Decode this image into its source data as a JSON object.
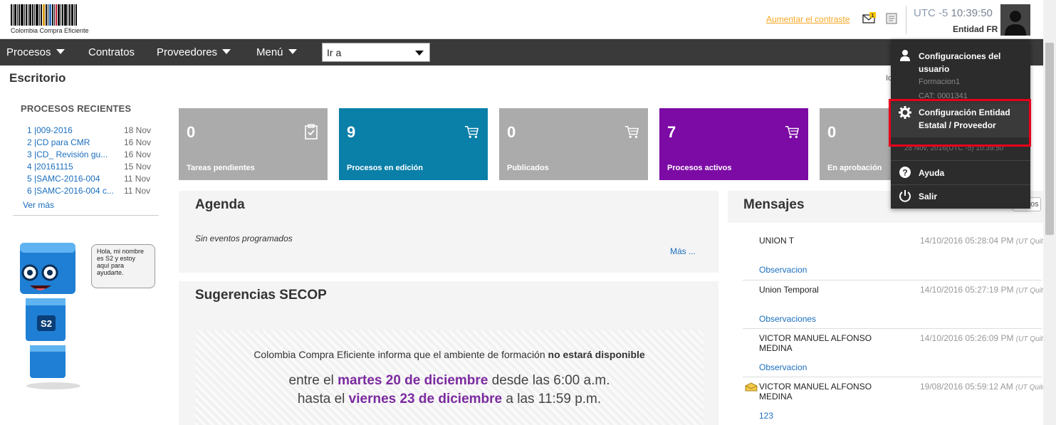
{
  "header": {
    "logo_text": "Colombia Compra Eficiente",
    "contrast_link": "Aumentar el contraste",
    "mail_badge": "1",
    "timezone": "UTC -5",
    "time": "10:39:50",
    "entity": "Entidad FR"
  },
  "nav": {
    "items": [
      {
        "label": "Procesos"
      },
      {
        "label": "Contratos"
      },
      {
        "label": "Proveedores"
      },
      {
        "label": "Menú"
      }
    ],
    "goto_value": "Ir a"
  },
  "page_title": "Escritorio",
  "sidebar": {
    "recent_title": "PROCESOS RECIENTES",
    "recent": [
      {
        "name": "1 |009-2016",
        "date": "18 Nov"
      },
      {
        "name": "2 |CD para CMR",
        "date": "16 Nov"
      },
      {
        "name": "3 |CD_ Revisión gu...",
        "date": "16 Nov"
      },
      {
        "name": "4 |20161115",
        "date": "15 Nov"
      },
      {
        "name": "5 |SAMC-2016-004",
        "date": "11 Nov"
      },
      {
        "name": "6 |SAMC-2016-004 c...",
        "date": "11 Nov"
      }
    ],
    "ver_mas": "Ver más",
    "bubble": "Hola, mi nombre es S2 y estoy aquí para ayudarte.",
    "robot_badge": "S2"
  },
  "tiles": [
    {
      "count": "0",
      "label": "Tareas pendientes",
      "color": "#ababab",
      "icon": "clipboard-check-icon"
    },
    {
      "count": "9",
      "label": "Procesos en edición",
      "color": "#0a7fa8",
      "icon": "cart-icon"
    },
    {
      "count": "0",
      "label": "Publicados",
      "color": "#ababab",
      "icon": "cart-icon"
    },
    {
      "count": "7",
      "label": "Procesos activos",
      "color": "#7c0aa5",
      "icon": "cart-icon"
    },
    {
      "count": "0",
      "label": "En aprobación",
      "color": "#ababab",
      "icon": "cart-icon"
    }
  ],
  "agenda": {
    "title": "Agenda",
    "empty": "Sin eventos programados",
    "more": "Más ..."
  },
  "suggestions": {
    "title": "Sugerencias SECOP",
    "line1_a": "Colombia Compra Eficiente informa que el ambiente de formación ",
    "line1_b": "no estará disponible",
    "line2_a": "entre el ",
    "line2_b": "martes 20 de diciembre",
    "line2_c": " desde las 6:00 a.m.",
    "line3_a": "hasta el ",
    "line3_b": "viernes 23 de diciembre",
    "line3_c": " a las 11:59 p.m."
  },
  "messages": {
    "title": "Mensajes",
    "button_fragment": "os",
    "items": [
      {
        "sender": "UNION T",
        "date": "14/10/2016 05:28:04 PM",
        "tz": "(UT Quito)",
        "subject": "Observacion"
      },
      {
        "sender": "Union Temporal",
        "date": "14/10/2016 05:27:19 PM",
        "tz": "(UT Quito)",
        "subject": "Observaciones"
      },
      {
        "sender": "VICTOR MANUEL ALFONSO MEDINA",
        "date": "14/10/2016 05:26:09 PM",
        "tz": "(UT Quito)",
        "subject": "Observacion"
      },
      {
        "sender": "VICTOR MANUEL ALFONSO MEDINA",
        "date": "19/08/2016 05:59:12 AM",
        "tz": "(UT Quito)",
        "subject": "123"
      }
    ]
  },
  "user_menu": {
    "user_settings": "Configuraciones del usuario",
    "user_name": "Formacion1",
    "user_code": "CAT: 0001341",
    "entity_settings": "Configuración Entidad Estatal / Proveedor",
    "timestamp": "28 Nov, 2016(UTC -5) 10:39:50",
    "help": "Ayuda",
    "logout": "Salir"
  },
  "right_fragment": "Id"
}
